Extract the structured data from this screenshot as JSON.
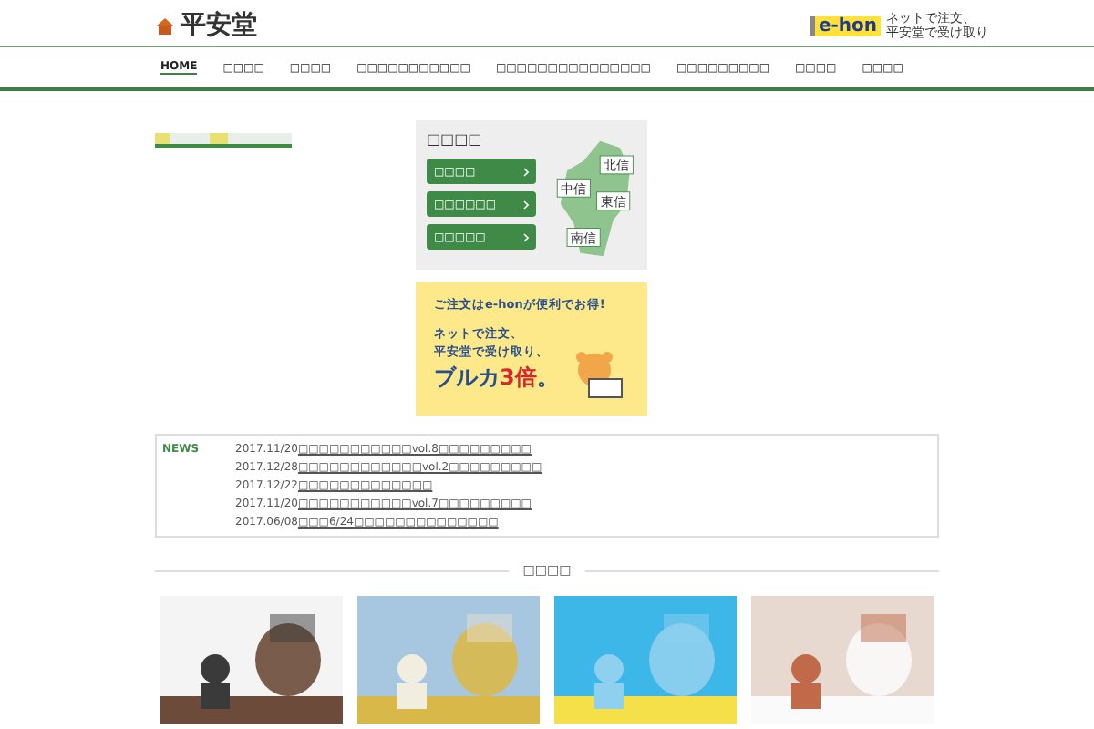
{
  "header": {
    "logo": "平安堂",
    "ehon": {
      "badge": "e-hon",
      "lines": [
        "ネットで注文、",
        "平安堂で受け取り"
      ]
    }
  },
  "nav": [
    {
      "label": "HOME",
      "selected": true
    },
    {
      "label": "□□□□",
      "selected": false
    },
    {
      "label": "□□□□",
      "selected": false
    },
    {
      "label": "□□□□□□□□□□□",
      "selected": false
    },
    {
      "label": "□□□□□□□□□□□□□□□",
      "selected": false
    },
    {
      "label": "□□□□□□□□□",
      "selected": false
    },
    {
      "label": "□□□□",
      "selected": false
    },
    {
      "label": "□□□□",
      "selected": false
    }
  ],
  "stores": {
    "title": "□□□□",
    "buttons": [
      "□□□□",
      "□□□□□□",
      "□□□□□"
    ],
    "map_labels": [
      "北信",
      "中信",
      "東信",
      "南信"
    ]
  },
  "banner": {
    "headline": "ご注文はe-honが便利でお得!",
    "lines": [
      "ネットで注文、",
      "平安堂で受け取り、"
    ],
    "slogan": "ブルカ**3倍**。"
  },
  "news": {
    "label": "NEWS",
    "items": [
      {
        "date": "2017.11/20",
        "title": "□□□□□□□□□□□vol.8□□□□□□□□□"
      },
      {
        "date": "2017.12/28",
        "title": "□□□□□□□□□□□□vol.2□□□□□□□□□"
      },
      {
        "date": "2017.12/22",
        "title": "□□□□□□□□□□□□□"
      },
      {
        "date": "2017.11/20",
        "title": "□□□□□□□□□□□vol.7□□□□□□□□□"
      },
      {
        "date": "2017.06/08",
        "title": "□□□6/24□□□□□□□□□□□□□□"
      }
    ]
  },
  "section": {
    "title": "□□□□"
  }
}
